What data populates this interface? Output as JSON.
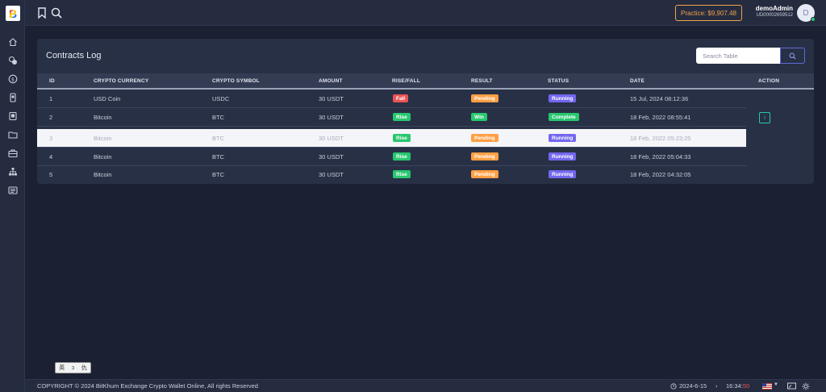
{
  "header": {
    "practice_label": "Practice: $9,907.48",
    "user_name": "demoAdmin",
    "user_id": "UD00002659512",
    "avatar_initial": "D"
  },
  "sidebar": {
    "items": [
      "home-icon",
      "coins-icon",
      "dollar-icon",
      "phone-icon",
      "wallet-card-icon",
      "folder-icon",
      "briefcase-icon",
      "sitemap-icon",
      "news-icon"
    ]
  },
  "card": {
    "title": "Contracts Log",
    "search_placeholder": "Search Table"
  },
  "table": {
    "columns": [
      "ID",
      "CRYPTO CURRENCY",
      "CRYPTO SYMBOL",
      "AMOUNT",
      "RISE/FALL",
      "RESULT",
      "STATUS",
      "DATE",
      "ACTION"
    ],
    "rows": [
      {
        "id": "1",
        "currency": "USD Coin",
        "symbol": "USDC",
        "amount": "30 USDT",
        "rise_fall": "Fall",
        "result": "Pending",
        "status": "Running",
        "date": "15 Jul, 2024 08:12:36"
      },
      {
        "id": "2",
        "currency": "Bitcoin",
        "symbol": "BTC",
        "amount": "30 USDT",
        "rise_fall": "Rise",
        "result": "Win",
        "status": "Complete",
        "date": "18 Feb, 2022 08:55:41"
      },
      {
        "id": "3",
        "currency": "Bitcoin",
        "symbol": "BTC",
        "amount": "30 USDT",
        "rise_fall": "Rise",
        "result": "Pending",
        "status": "Running",
        "date": "18 Feb, 2022 05:23:25"
      },
      {
        "id": "4",
        "currency": "Bitcoin",
        "symbol": "BTC",
        "amount": "30 USDT",
        "rise_fall": "Rise",
        "result": "Pending",
        "status": "Running",
        "date": "18 Feb, 2022 05:04:33"
      },
      {
        "id": "5",
        "currency": "Bitcoin",
        "symbol": "BTC",
        "amount": "30 USDT",
        "rise_fall": "Rise",
        "result": "Pending",
        "status": "Running",
        "date": "18 Feb, 2022 04:32:05"
      }
    ],
    "action_label": "i"
  },
  "lang_switcher": {
    "items": [
      "英",
      "ɔ",
      "仇"
    ]
  },
  "footer": {
    "copyright": "COPYRIGHT © 2024 BitKhum Exchange Crypto Wallet Online, All rights Reserved",
    "date": "2024-6-15",
    "time_hm": "16:34:",
    "time_s": "50"
  },
  "colors": {
    "background": "#1b2032",
    "card": "#283046",
    "accent_orange": "#f0a24a",
    "fall_red": "#ea5455",
    "rise_green": "#28c76f",
    "pending_orange": "#ff9f43",
    "running_purple": "#7367f0"
  }
}
